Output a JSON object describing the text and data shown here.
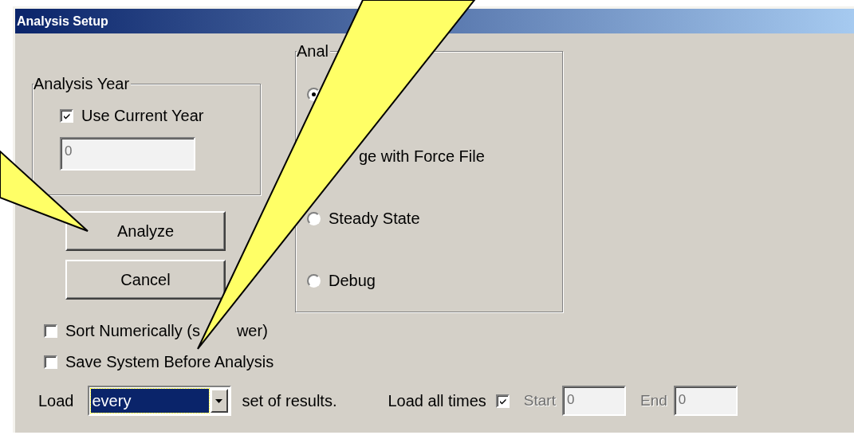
{
  "window": {
    "title": "Analysis Setup"
  },
  "analysis_year": {
    "title": "Analysis Year",
    "use_current_year": {
      "label": "Use Current Year",
      "checked": true
    },
    "year_field": {
      "value": "0",
      "disabled": true
    }
  },
  "buttons": [
    {
      "label": "Analyze"
    },
    {
      "label": "Cancel"
    }
  ],
  "analysis_group": {
    "title": "Anal",
    "options": [
      {
        "selected": true
      },
      {
        "label": "ge with Force File"
      },
      {
        "label": "Steady State",
        "selected": false
      },
      {
        "label": "Debug",
        "selected": false
      }
    ]
  },
  "checkboxes": [
    {
      "label": "Sort Numerically (s",
      "label_after_cover": "wer)",
      "checked": false
    },
    {
      "label": "Save System Before Analysis",
      "checked": false
    }
  ],
  "load_row": {
    "label": "Load",
    "dropdown": {
      "value": "every",
      "focused": true
    },
    "suffix": "set of results."
  },
  "load_all_times": {
    "label": "Load all times",
    "checked": true
  },
  "start": {
    "label": "Start",
    "value": "0",
    "disabled": true
  },
  "end": {
    "label": "End",
    "value": "0",
    "disabled": true
  }
}
